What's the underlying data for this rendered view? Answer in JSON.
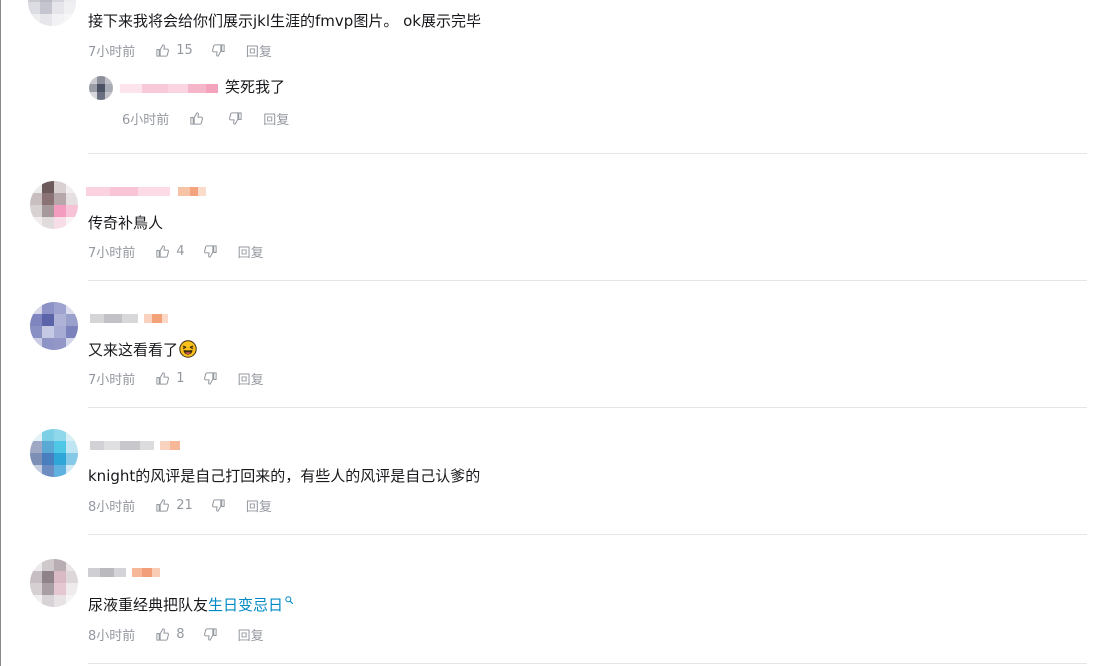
{
  "comments": [
    {
      "text": "接下来我将会给你们展示jkl生涯的fmvp图片。 ok展示完毕",
      "time": "7小时前",
      "likes": "15",
      "reply_label": "回复",
      "replies": [
        {
          "text": "笑死我了",
          "time": "6小时前",
          "likes": "",
          "reply_label": "回复"
        }
      ]
    },
    {
      "text": "传奇补鳥人",
      "time": "7小时前",
      "likes": "4",
      "reply_label": "回复"
    },
    {
      "text": "又来这看看了",
      "emoji": "laughing-emoji",
      "time": "7小时前",
      "likes": "1",
      "reply_label": "回复"
    },
    {
      "text": "knight的风评是自己打回来的，有些人的风评是自己认爹的",
      "time": "8小时前",
      "likes": "21",
      "reply_label": "回复"
    },
    {
      "text_prefix": "尿液重经典把队友",
      "keyword": "生日变忌日",
      "keyword_icon": "search-icon",
      "time": "8小时前",
      "likes": "8",
      "reply_label": "回复"
    }
  ],
  "colors": {
    "meta_text": "#9499a0",
    "keyword_link": "#008ac5",
    "divider": "#e3e5e7"
  }
}
